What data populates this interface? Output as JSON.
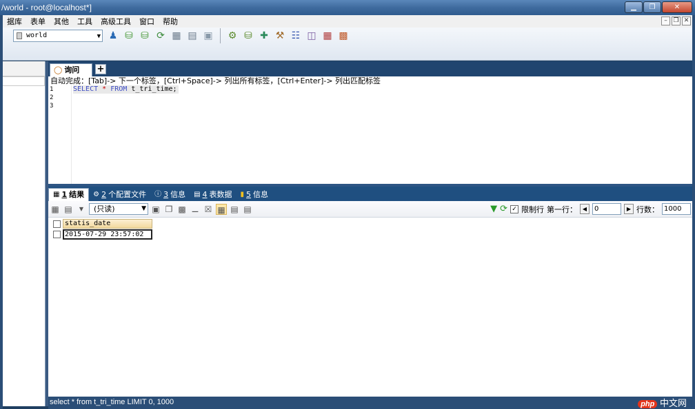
{
  "window": {
    "title": "/world - root@localhost*]",
    "minimize": "▁",
    "restore": "❐",
    "close": "✕"
  },
  "menu": {
    "items": [
      "据库",
      "表单",
      "其他",
      "工具",
      "高级工具",
      "窗口",
      "帮助"
    ],
    "mdi_min": "–",
    "mdi_restore": "❐",
    "mdi_close": "✕"
  },
  "toolbar": {
    "database": "world"
  },
  "editor": {
    "tab_label": "询问",
    "add_tab": "+",
    "hint": "自动完成：[Tab]-> 下一个标签，[Ctrl+Space]-> 列出所有标签，[Ctrl+Enter]-> 列出匹配标签",
    "line_numbers": [
      "1",
      "2",
      "3"
    ],
    "sql": {
      "select": "SELECT",
      "star": "*",
      "from": "FROM",
      "rest": "t_tri_time;"
    }
  },
  "results": {
    "tabs": [
      {
        "num": "1",
        "label": "结果"
      },
      {
        "num": "2",
        "label": "个配置文件"
      },
      {
        "num": "3",
        "label": "信息"
      },
      {
        "num": "4",
        "label": "表数据"
      },
      {
        "num": "5",
        "label": "信息"
      }
    ],
    "mode": "(只读)",
    "limit_label": "限制行",
    "first_row_label": "第一行：",
    "first_row_value": "0",
    "rows_label": "行数：",
    "rows_value": "1000",
    "column": "statis_date",
    "cell": "2015-07-29 23:57:02"
  },
  "status": {
    "text": "select * from t_tri_time LIMIT 0, 1000",
    "watermark_php": "php",
    "watermark_text": "中文网"
  }
}
